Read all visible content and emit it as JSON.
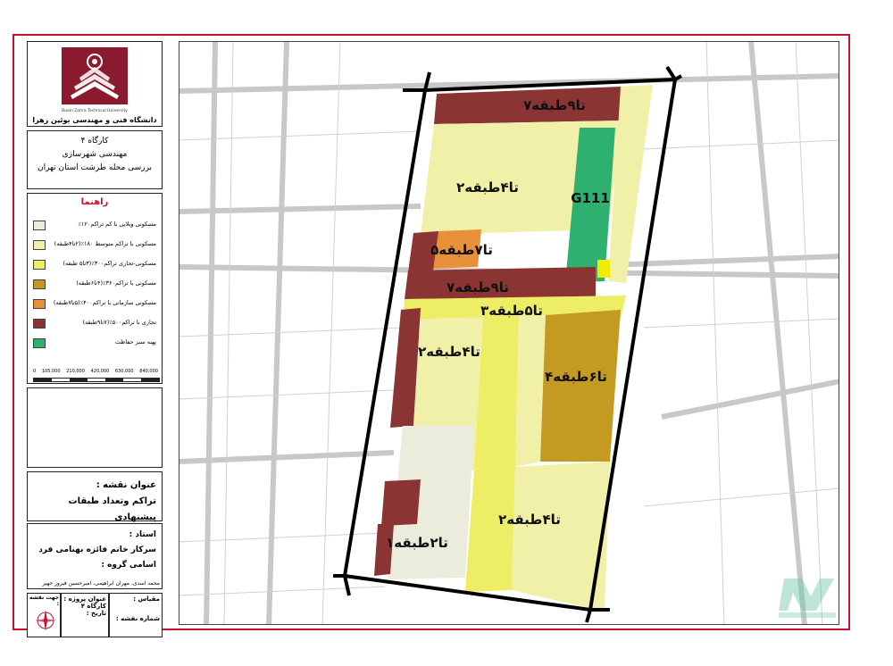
{
  "university": {
    "name": "دانشگاه فنی و مهندسی بوئین زهرا",
    "name_en": "Buein Zahra Technical University"
  },
  "workshop": {
    "line1": "کارگاه ۴",
    "line2": "مهندسی شهرسازی",
    "line3": "بررسی محله طرشت استان تهران"
  },
  "legend": {
    "title": "راهنما",
    "items": [
      {
        "label": "مسکونی ویلایی با کم تراکم۱۲۰٪",
        "color": "#ececdc"
      },
      {
        "label": "مسکونی با تراکم متوسط ۱۸۰٪(۲تا۴طبقه)",
        "color": "#f0f0a8"
      },
      {
        "label": "مسکونی-تجاری تراکم۳۰۰٪(۳تا۵ طبقه)",
        "color": "#eded66"
      },
      {
        "label": "مسکونی با تراکم۳۶۰٪(۴تا۶طبقه)",
        "color": "#c49a22"
      },
      {
        "label": "مسکونی سازمانی با تراکم۴۰۰٪(۵تا۷طبقه)",
        "color": "#e8903a"
      },
      {
        "label": "تجاری با تراکم۵۰۰٪(۷تا۹طبقه)",
        "color": "#8a3434"
      },
      {
        "label": "پهنه سبز حفاظت",
        "color": "#2eb070"
      }
    ],
    "scale_labels": [
      "0",
      "105,000",
      "210,000",
      "420,000",
      "630,000",
      "840,000"
    ]
  },
  "map_title": {
    "label": "عنوان نقشه :",
    "value": "تراکم وتعداد طبقات پیشنهادی"
  },
  "teacher": {
    "label": "استاد :",
    "value": "سرکار خانم فائزه بهنامی فرد",
    "group_label": "اسامی گروه :",
    "students": "محمد اسدی، مهران ابراهیمی، امیرحسین فیروز جهیر"
  },
  "footer": {
    "north": "جهت نقشه :",
    "project_label": "عنوان پروژه :",
    "project_value": "کارگاه ۴",
    "date_label": "تاریخ :",
    "scale_label": "مقیاس :",
    "map_number_label": "شماره نقشه :"
  },
  "map_labels": {
    "top": "۷تا۹طبقه",
    "upper_left": "۲تا۴طبقه",
    "green": "G111",
    "orange": "۵تا۷طبقه",
    "middle_brown": "۷تا۹طبقه",
    "middle_yellow": "۳تا۵طبقه",
    "left_mid": "۲تا۴طبقه",
    "right_gold": "۴تا۶طبقه",
    "bottom_right": "۲تا۴طبقه",
    "bottom_left": "۱تا۲طبقه"
  },
  "colors": {
    "frame": "#c8102e",
    "villa": "#ececdc",
    "medium": "#f0f0a8",
    "mixed": "#eded66",
    "gold": "#c49a22",
    "orange": "#e8903a",
    "commercial": "#8a3434",
    "green": "#2eb070"
  }
}
